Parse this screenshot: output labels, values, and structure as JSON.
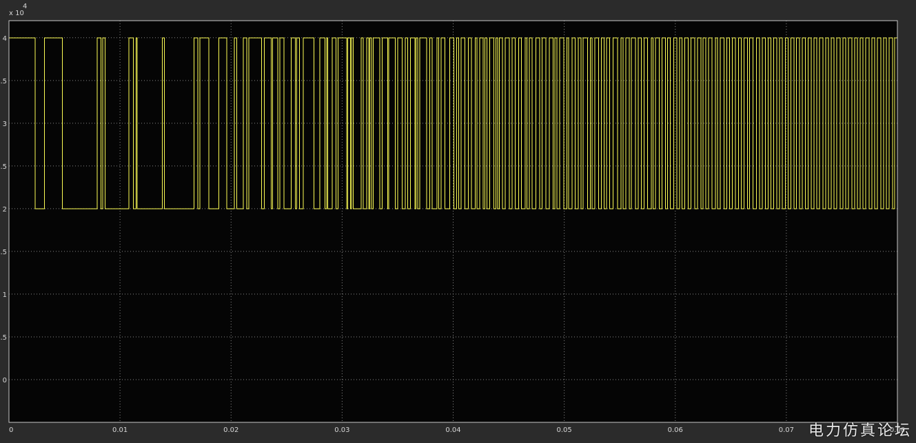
{
  "watermark": "电力仿真论坛",
  "colors": {
    "background": "#2b2b2b",
    "plot_background": "#050505",
    "grid": "#8a8a8a",
    "axis": "#c8c8c8",
    "trace": "#ffff55"
  },
  "chart_data": {
    "type": "line",
    "step": true,
    "title": "",
    "xlabel": "",
    "ylabel": "",
    "y_exponent_label": "x 10",
    "y_exponent": "4",
    "xlim": [
      0,
      0.08
    ],
    "ylim": [
      -0.5,
      4.2
    ],
    "grid": true,
    "x_ticks": [
      0,
      0.01,
      0.02,
      0.03,
      0.04,
      0.05,
      0.06,
      0.07,
      0.08
    ],
    "x_tick_labels": [
      "0",
      "0.01",
      "0.02",
      "0.03",
      "0.04",
      "0.05",
      "0.06",
      "0.07",
      "0.08"
    ],
    "y_ticks": [
      0,
      0.5,
      1,
      1.5,
      2,
      2.5,
      3,
      3.5,
      4
    ],
    "y_tick_labels": [
      "0",
      ".5",
      "1",
      ".5",
      "2",
      ".5",
      "3",
      ".5",
      "4"
    ],
    "levels": [
      2,
      4
    ],
    "series": [
      {
        "initial_value": 4,
        "switch_times": [
          0.00235,
          0.0032,
          0.0048,
          0.00795,
          0.0083,
          0.00845,
          0.00865,
          0.0108,
          0.0112,
          0.01145,
          0.01155,
          0.0138,
          0.014,
          0.01665,
          0.017,
          0.0172,
          0.018,
          0.0189,
          0.0196,
          0.0203,
          0.0205,
          0.0211,
          0.0214,
          0.0216,
          0.02275,
          0.023,
          0.0236,
          0.02375,
          0.0242,
          0.0244,
          0.02475,
          0.0254,
          0.0258,
          0.0259,
          0.02615,
          0.0265,
          0.02745,
          0.028,
          0.02845,
          0.0286,
          0.0287,
          0.0291,
          0.02945,
          0.02965,
          0.0304,
          0.0305,
          0.03075,
          0.03085,
          0.031,
          0.0317,
          0.0319,
          0.0322,
          0.0324,
          0.0325,
          0.03265,
          0.0328,
          0.0334,
          0.0336,
          0.0341,
          0.0342,
          0.0348,
          0.035,
          0.0354,
          0.0357,
          0.0359,
          0.03615,
          0.03655,
          0.03665,
          0.0368,
          0.037,
          0.0376,
          0.0379,
          0.0381,
          0.03855,
          0.0387,
          0.0389,
          0.03925,
          0.0397,
          0.04005,
          0.0403,
          0.0405,
          0.0407,
          0.04105,
          0.04135,
          0.04165,
          0.042,
          0.04215,
          0.0424,
          0.0427,
          0.04285,
          0.04305,
          0.0433,
          0.04365,
          0.04385,
          0.044,
          0.04415,
          0.04445,
          0.0447,
          0.04505,
          0.0453,
          0.0456,
          0.0459,
          0.04615,
          0.0465,
          0.04665,
          0.04685,
          0.0471,
          0.04745,
          0.0478,
          0.048,
          0.04835,
          0.04865,
          0.049,
          0.04915,
          0.04935,
          0.0496,
          0.04995,
          0.05025,
          0.0504,
          0.0507,
          0.051,
          0.05125,
          0.0515,
          0.0517,
          0.0521,
          0.05235,
          0.0525,
          0.05275,
          0.0531,
          0.05335,
          0.0536,
          0.0538,
          0.0541,
          0.0544,
          0.0548,
          0.0551,
          0.0553,
          0.05555,
          0.05585,
          0.05605,
          0.0564,
          0.05665,
          0.05695,
          0.0572,
          0.0575,
          0.05785,
          0.058,
          0.0582,
          0.05855,
          0.0588,
          0.0591,
          0.0593,
          0.05955,
          0.05985,
          0.06015,
          0.0604,
          0.0606,
          0.06085,
          0.06115,
          0.0614,
          0.06175,
          0.062,
          0.0623,
          0.0625,
          0.06275,
          0.063,
          0.0633,
          0.0636,
          0.0638,
          0.06405,
          0.0644,
          0.06465,
          0.0649,
          0.06515,
          0.0654,
          0.0657,
          0.06595,
          0.0662,
          0.0665,
          0.0667,
          0.067,
          0.0673,
          0.0676,
          0.06785,
          0.0681,
          0.06835,
          0.0686,
          0.06885,
          0.06915,
          0.0694,
          0.06965,
          0.0699,
          0.07015,
          0.0704,
          0.0707,
          0.0709,
          0.0712,
          0.07145,
          0.0717,
          0.07195,
          0.07225,
          0.0725,
          0.07275,
          0.073,
          0.0733,
          0.07355,
          0.0738,
          0.07405,
          0.0743,
          0.07455,
          0.07485,
          0.0751,
          0.07535,
          0.0756,
          0.0759,
          0.07615,
          0.0764,
          0.07665,
          0.0769,
          0.07715,
          0.07745,
          0.0777,
          0.07795,
          0.0782,
          0.0785,
          0.07875,
          0.079,
          0.07925,
          0.07955,
          0.07975
        ]
      }
    ]
  }
}
